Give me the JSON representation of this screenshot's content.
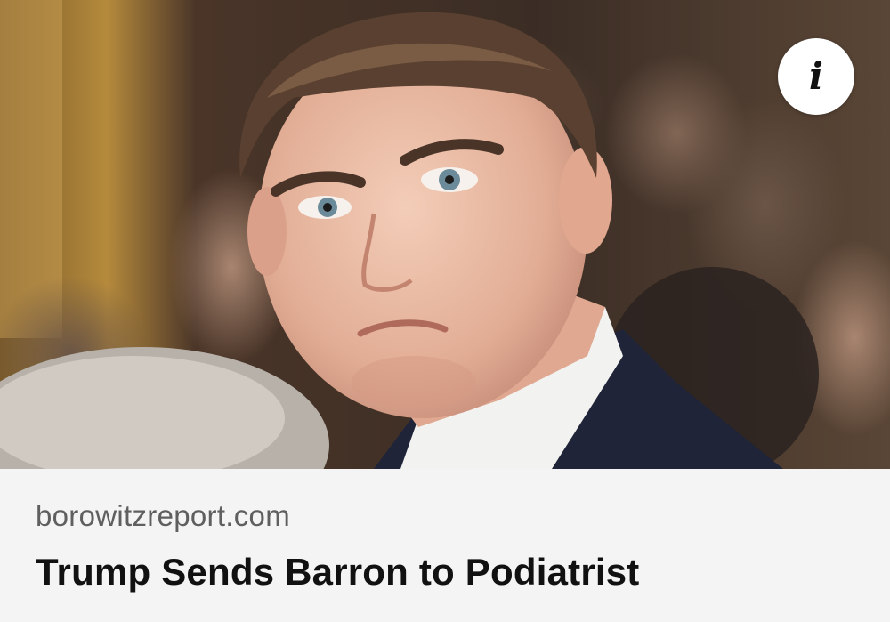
{
  "link_preview": {
    "image": {
      "alt": "Barron Trump"
    },
    "info_icon": "info-icon",
    "info_glyph": "i",
    "domain": "borowitzreport.com",
    "headline": "Trump Sends Barron to Podiatrist"
  },
  "colors": {
    "card_background": "#f4f4f4",
    "domain_text": "#5f5f5f",
    "headline_text": "#111111",
    "info_button_background": "#ffffff"
  }
}
